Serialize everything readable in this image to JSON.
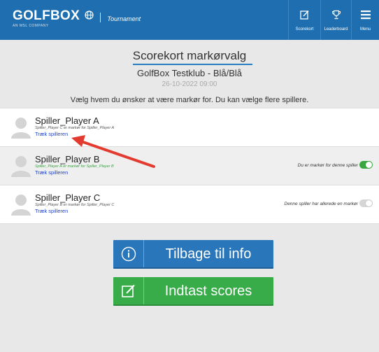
{
  "header": {
    "logo_text": "GOLFBOX",
    "logo_sub": "AN MSL COMPANY",
    "tournament_label": "Tournament",
    "nav": [
      {
        "label": "Scorekort",
        "icon": "scorecard-icon"
      },
      {
        "label": "Leaderboard",
        "icon": "trophy-icon"
      },
      {
        "label": "Menu",
        "icon": "menu-icon"
      }
    ],
    "colors": {
      "bar": "#1f6fb0"
    }
  },
  "main": {
    "title": "Scorekort markørvalg",
    "club": "GolfBox Testklub - Blå/Blå",
    "date": "26-10-2022 09:00",
    "instruction": "Vælg hvem du ønsker at være markør for. Du kan vælge flere spillere."
  },
  "players": [
    {
      "name": "Spiller_Player A",
      "marker": "Spiller_Player C er markør for Spiller_Player A",
      "link": "Træk spilleren",
      "status": "",
      "toggle": "none"
    },
    {
      "name": "Spiller_Player B",
      "marker": "Spiller_Player A er markør for Spiller_Player B",
      "link": "Træk spilleren",
      "status": "Du er markør for denne spiller",
      "toggle": "on"
    },
    {
      "name": "Spiller_Player C",
      "marker": "Spiller_Player B er markør for Spiller_Player C",
      "link": "Træk spilleren",
      "status": "Denne spiller har allerede en markør",
      "toggle": "off"
    }
  ],
  "buttons": {
    "info": {
      "label": "Tilbage til info",
      "icon": "info-icon",
      "color": "#2a76ba"
    },
    "scores": {
      "label": "Indtast scores",
      "icon": "edit-scorecard-icon",
      "color": "#37ac49"
    }
  }
}
